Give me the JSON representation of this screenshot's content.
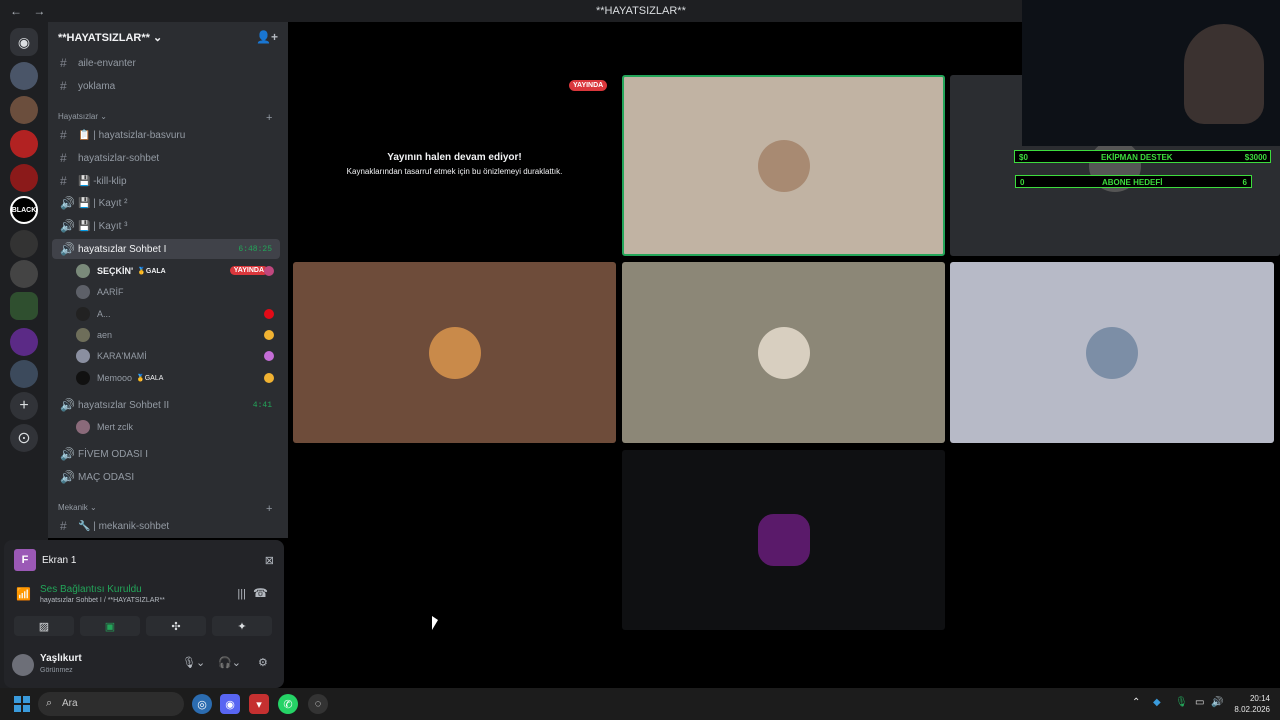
{
  "window": {
    "title": "**HAYATSIZLAR**",
    "back": "←",
    "forward": "→"
  },
  "servers": {
    "black_label": "BLACK",
    "add": "+",
    "explore": "⊙"
  },
  "server": {
    "name": "**HAYATSIZLAR** ⌄",
    "channels_top": [
      {
        "label": "aile-envanter",
        "symbol": "#"
      },
      {
        "label": "yoklama",
        "symbol": "#"
      }
    ],
    "categories": {
      "hayatsizlar": "Hayatsızlar ⌄",
      "mekanik": "Mekanik ⌄"
    },
    "channels_main": [
      {
        "label": "📋 | hayatsizlar-basvuru",
        "symbol": "#"
      },
      {
        "label": "hayatsizlar-sohbet",
        "symbol": "#"
      },
      {
        "label": "💾 -kill-klip",
        "symbol": "#"
      },
      {
        "label": "💾 | Kayıt ²",
        "symbol": "🔊"
      },
      {
        "label": "💾 | Kayıt ³",
        "symbol": "🔊"
      }
    ],
    "voice_active": {
      "label": "hayatsızlar Sohbet I",
      "time": "6:48:25"
    },
    "voice_users": [
      {
        "name": "SEÇKİN'",
        "tag": "🥇GALA",
        "live": "YAYINDA"
      },
      {
        "name": "AARİF"
      },
      {
        "name": "A..."
      },
      {
        "name": "aen"
      },
      {
        "name": "KARA'MAMİ"
      },
      {
        "name": "Memooo",
        "tag": "🥇GALA"
      }
    ],
    "voice_second": {
      "label": "hayatsızlar Sohbet II",
      "time": "4:41"
    },
    "voice_second_users": [
      {
        "name": "Mert zclk"
      }
    ],
    "voice_other": [
      {
        "label": "FİVEM ODASI I"
      },
      {
        "label": "MAÇ ODASI"
      }
    ],
    "mekanik_channels": [
      {
        "label": "🔧 | mekanik-sohbet",
        "symbol": "#"
      }
    ]
  },
  "panel": {
    "stream_letter": "F",
    "stream_name": "Ekran 1",
    "voice_status": "Ses Bağlantısı Kuruldu",
    "voice_sub": "hayatsızlar Sohbet I / **HAYATSIZLAR**",
    "user_name": "Yaşlıkurt",
    "user_status": "Görünmez"
  },
  "stage": {
    "live_chip": "YAYINDA",
    "paused_title": "Yayının halen devam ediyor!",
    "paused_sub": "Kaynaklarından tasarruf etmek için bu önizlemeyi duraklattık."
  },
  "overlay": {
    "row1_left": "$0",
    "row1_mid": "EKİPMAN DESTEK",
    "row1_right": "$3000",
    "row2_left": "0",
    "row2_mid": "ABONE HEDEFİ",
    "row2_right": "6"
  },
  "taskbar": {
    "search_placeholder": "Ara",
    "time": "20:14",
    "date": "8.02.2026"
  },
  "colors": {
    "live_red": "#da373c",
    "voice_green": "#23a559",
    "overlay_green": "#3ddc3d"
  }
}
